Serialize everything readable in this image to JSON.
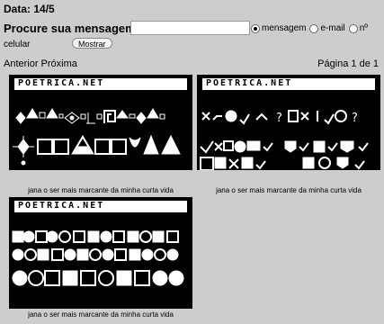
{
  "header": {
    "date": "Data: 14/5"
  },
  "search": {
    "label": "Procure sua mensagem:",
    "value": "",
    "options": [
      "mensagem",
      "e-mail",
      "nº"
    ],
    "option_continuation": "celular",
    "selected": "mensagem",
    "button_label": "Mostrar"
  },
  "pagination": {
    "prev_label": "Anterior",
    "next_label": "Próxima",
    "page_label": "Página 1 de 1"
  },
  "cards": [
    {
      "brand": "POETRICA.NET",
      "caption": "jana o ser mais marcante da minha curta vida"
    },
    {
      "brand": "POETRICA.NET",
      "caption": "jana o ser mais marcante da minha curta vida"
    },
    {
      "brand": "POETRICA.NET",
      "caption": "jana o ser mais marcante da minha curta vida"
    }
  ],
  "colors": {
    "background": "#cdcdcd",
    "card": "#000000",
    "symbols": "#ffffff"
  }
}
